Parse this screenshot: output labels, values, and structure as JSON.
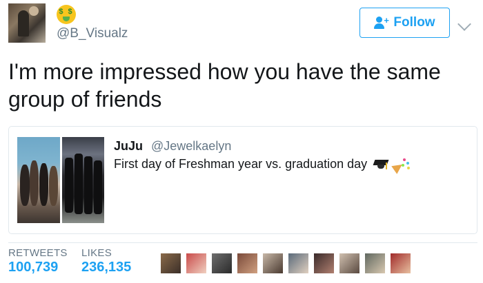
{
  "author": {
    "handle": "@B_Visualz",
    "avatar_icon": "user-photo-avatar",
    "badge_icon": "money-mouth-face-emoji"
  },
  "follow_button": {
    "label": "Follow",
    "icon": "follow-user-plus-icon",
    "color": "#1da1f2"
  },
  "menu_icon": "chevron-down-icon",
  "tweet": {
    "text": "I'm more impressed how you have the same group of friends"
  },
  "quoted_tweet": {
    "name": "JuJu",
    "handle": "@Jewelkaelyn",
    "text": "First day of Freshman year vs. graduation day",
    "emojis": [
      "graduation-cap-emoji",
      "party-popper-emoji"
    ],
    "images": [
      "freshman-group-photo",
      "graduation-group-photo"
    ]
  },
  "stats": {
    "retweets_label": "RETWEETS",
    "retweets_value": "100,739",
    "likes_label": "LIKES",
    "likes_value": "236,135"
  },
  "liker_avatars": [
    {
      "colors": [
        "#8a6a4a",
        "#3b2f28"
      ]
    },
    {
      "colors": [
        "#c94a4a",
        "#f0d0c0"
      ]
    },
    {
      "colors": [
        "#6e6e6e",
        "#2a2a2a"
      ]
    },
    {
      "colors": [
        "#7a4a3a",
        "#d0a080"
      ]
    },
    {
      "colors": [
        "#c8b8a8",
        "#4a3a30"
      ]
    },
    {
      "colors": [
        "#5a6a7a",
        "#e0d0c0"
      ]
    },
    {
      "colors": [
        "#3a2a2a",
        "#b08070"
      ]
    },
    {
      "colors": [
        "#d0c0b0",
        "#5a4a40"
      ]
    },
    {
      "colors": [
        "#606860",
        "#d8c8b0"
      ]
    },
    {
      "colors": [
        "#a02a2a",
        "#e8c0a0"
      ]
    }
  ]
}
